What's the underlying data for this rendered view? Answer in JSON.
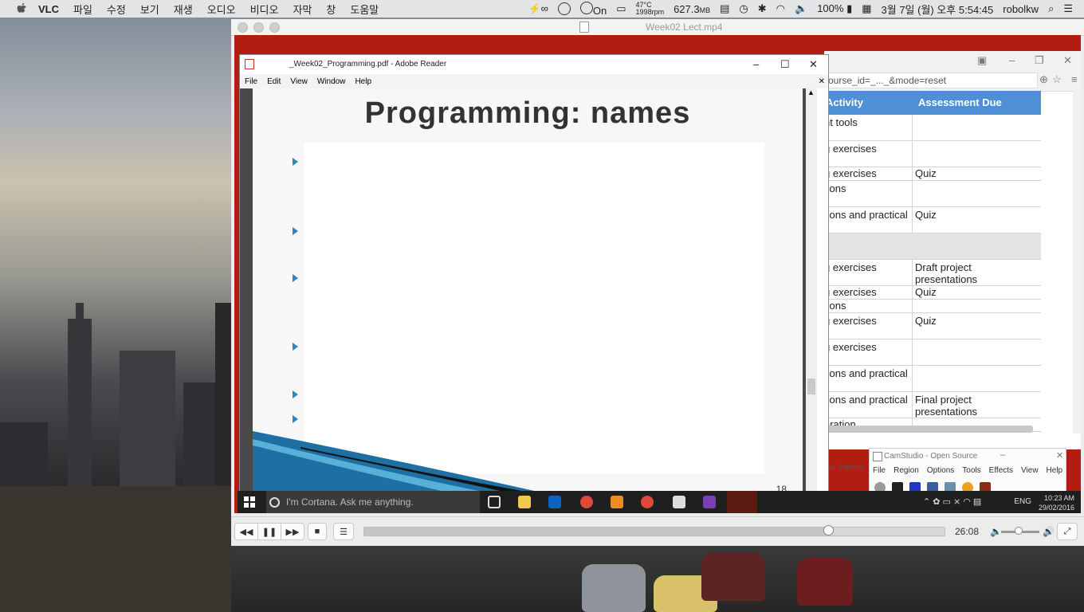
{
  "menubar": {
    "app_name": "VLC",
    "items": [
      "파일",
      "수정",
      "보기",
      "재생",
      "오디오",
      "비디오",
      "자막",
      "창",
      "도움말"
    ],
    "status": {
      "infinity": "∞",
      "on_label": "On",
      "temperature": "47°C",
      "rpm": "1998rpm",
      "memory": "627.3",
      "memory_unit": "MB",
      "battery": "100%",
      "datetime": "3월 7일 (월) 오후 5:54:45",
      "user": "robolkw"
    }
  },
  "vlc": {
    "title": "Week02 Lect.mp4",
    "current_time": "26:08",
    "progress_fraction": 0.8,
    "volume_fraction": 0.45
  },
  "reader": {
    "title": "_Week02_Programming.pdf - Adobe Reader",
    "menu": [
      "File",
      "Edit",
      "View",
      "Window",
      "Help"
    ],
    "slide_title": "Programming: names",
    "page_number": "18",
    "bullet_count": 6
  },
  "browser": {
    "url": "ourse_id=_..._&mode=reset",
    "headers": [
      "Activity",
      "Assessment Due"
    ],
    "rows": [
      {
        "a": "nt tools",
        "b": ""
      },
      {
        "a": "g exercises",
        "b": ""
      },
      {
        "a": "g exercises",
        "b": "Quiz"
      },
      {
        "a": "tions",
        "b": ""
      },
      {
        "a": "tions and practical",
        "b": "Quiz"
      },
      {
        "a": "",
        "b": ""
      },
      {
        "a": "g exercises",
        "b": "Draft project presentations"
      },
      {
        "a": "g exercises",
        "b": "Quiz"
      },
      {
        "a": "tions",
        "b": ""
      },
      {
        "a": "g exercises",
        "b": "Quiz"
      },
      {
        "a": "g exercises",
        "b": ""
      },
      {
        "a": "tions and practical",
        "b": ""
      },
      {
        "a": "tions and practical",
        "b": "Final project presentations"
      },
      {
        "a": "aration",
        "b": ""
      }
    ],
    "footer": "nal Patent"
  },
  "camstudio": {
    "title": "CamStudio - Open Source",
    "menu": [
      "File",
      "Region",
      "Options",
      "Tools",
      "Effects",
      "View",
      "Help"
    ]
  },
  "taskbar": {
    "cortana": "I'm Cortana. Ask me anything.",
    "lang": "ENG",
    "time": "10:23 AM",
    "date": "29/02/2016"
  },
  "colors": {
    "vlc_frame": "#b31c10",
    "table_header": "#4f8fd6",
    "bullet": "#2e86b8"
  }
}
